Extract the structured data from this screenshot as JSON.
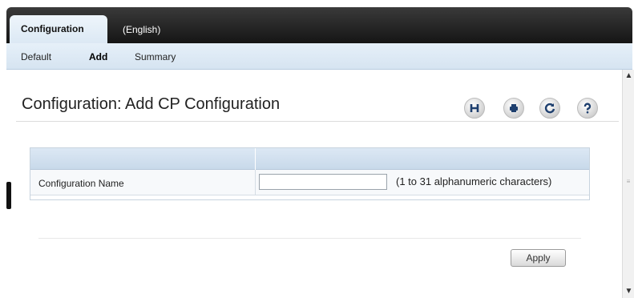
{
  "tabs": [
    {
      "label": "Configuration",
      "active": true
    },
    {
      "label": "(English)",
      "active": false
    }
  ],
  "subnav": [
    {
      "label": "Default",
      "active": false
    },
    {
      "label": "Add",
      "active": true
    },
    {
      "label": "Summary",
      "active": false
    }
  ],
  "page": {
    "title": "Configuration: Add CP Configuration"
  },
  "toolbar": {
    "icons": [
      "save-icon",
      "print-icon",
      "refresh-icon",
      "help-icon"
    ]
  },
  "form": {
    "field_label": "Configuration Name",
    "field_value": "",
    "field_hint": "(1 to 31 alphanumeric characters)"
  },
  "actions": {
    "apply_label": "Apply"
  },
  "colors": {
    "tabbar_dark": "#151515",
    "subnav_bg": "#d6e4f1",
    "table_header_bg": "#c8d9ea"
  }
}
